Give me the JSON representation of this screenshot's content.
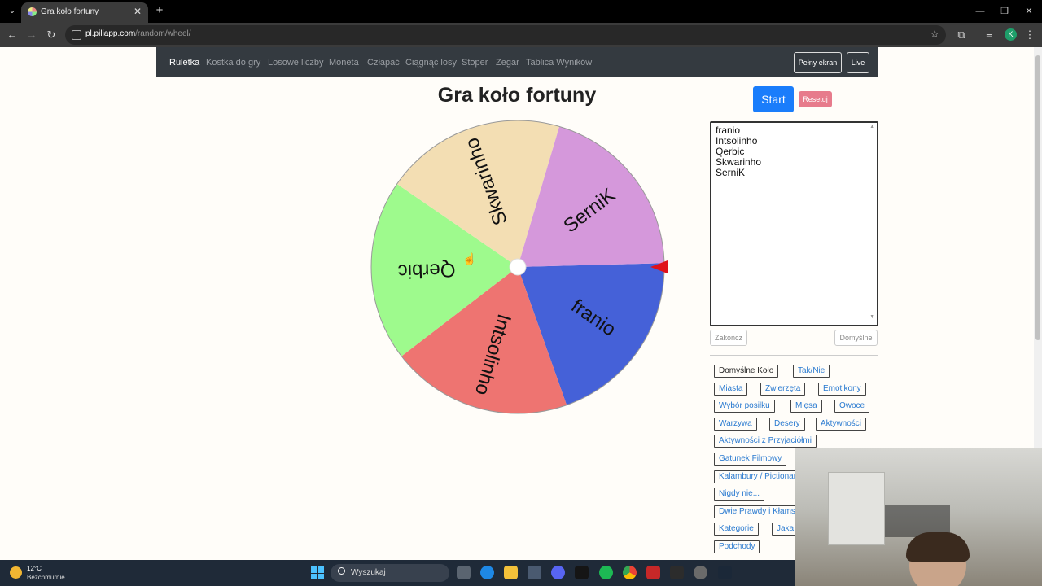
{
  "browser": {
    "tab_title": "Gra koło fortuny",
    "url_host": "pl.piliapp.com",
    "url_path": "/random/wheel/",
    "avatar_letter": "K"
  },
  "navbar": {
    "links": [
      "Ruletka",
      "Kostka do gry",
      "Losowe liczby",
      "Moneta",
      "Człapać",
      "Ciągnąć losy",
      "Stoper",
      "Zegar",
      "Tablica Wyników"
    ],
    "fullscreen_label": "Pełny ekran",
    "live_label": "Live"
  },
  "page": {
    "title": "Gra koło fortuny",
    "start_label": "Start",
    "reset_label": "Resetuj"
  },
  "wheel": {
    "segments": [
      {
        "label": "franio",
        "color": "#4561d8"
      },
      {
        "label": "Intsolinho",
        "color": "#ee7471"
      },
      {
        "label": "Qerbic",
        "color": "#9efa8d"
      },
      {
        "label": "Skwarinho",
        "color": "#f3deb3"
      },
      {
        "label": "SerniK",
        "color": "#d598db"
      }
    ],
    "pointer_color": "#e0111a"
  },
  "entries": [
    "franio",
    "Intsolinho",
    "Qerbic",
    "Skwarinho",
    "SerniK"
  ],
  "entry_buttons": {
    "finish_label": "Zakończ",
    "default_label": "Domyślne"
  },
  "presets": [
    "Domyślne Koło",
    "Tak/Nie",
    "Miasta",
    "Zwierzęta",
    "Emotikony",
    "Wybór posiłku",
    "Mięsa",
    "Owoce",
    "Warzywa",
    "Desery",
    "Aktywności",
    "Aktywności z Przyjaciółmi",
    "Gatunek Filmowy",
    "Kalambury / Pictionary",
    "Nigdy nie...",
    "Dwie Prawdy i Kłamstwo",
    "Kategorie",
    "Jaka",
    "Podchody"
  ],
  "taskbar": {
    "temperature": "12°C",
    "weather": "Bezchmurnie",
    "search_placeholder": "Wyszukaj"
  }
}
